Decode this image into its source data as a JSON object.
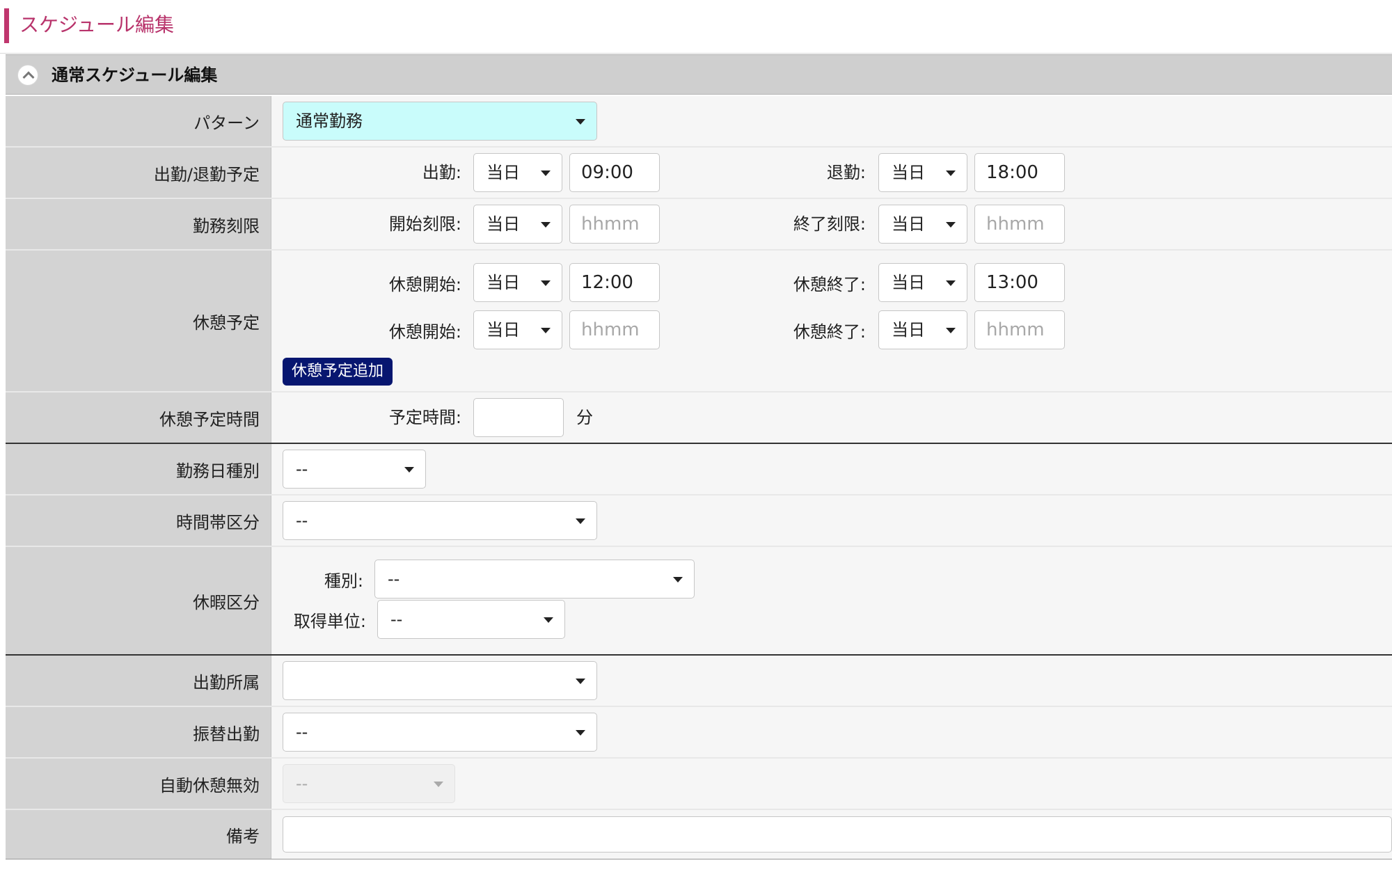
{
  "page": {
    "title": "スケジュール編集"
  },
  "section": {
    "title": "通常スケジュール編集"
  },
  "colors": {
    "accent": "#c0366e",
    "pattern_bg": "#c9fcfb",
    "button_bg": "#071670"
  },
  "pattern": {
    "label": "パターン",
    "value": "通常勤務"
  },
  "attendance": {
    "label": "出勤/退勤予定",
    "start_label": "出勤:",
    "start_day": "当日",
    "start_time": "09:00",
    "end_label": "退勤:",
    "end_day": "当日",
    "end_time": "18:00"
  },
  "work_limit": {
    "label": "勤務刻限",
    "start_label": "開始刻限:",
    "start_day": "当日",
    "start_placeholder": "hhmm",
    "end_label": "終了刻限:",
    "end_day": "当日",
    "end_placeholder": "hhmm"
  },
  "breaks": {
    "label": "休憩予定",
    "rows": [
      {
        "start_label": "休憩開始:",
        "start_day": "当日",
        "start_time": "12:00",
        "end_label": "休憩終了:",
        "end_day": "当日",
        "end_time": "13:00"
      },
      {
        "start_label": "休憩開始:",
        "start_day": "当日",
        "start_placeholder": "hhmm",
        "end_label": "休憩終了:",
        "end_day": "当日",
        "end_placeholder": "hhmm"
      }
    ],
    "add_button": "休憩予定追加"
  },
  "break_time": {
    "label": "休憩予定時間",
    "field_label": "予定時間:",
    "value": "",
    "unit": "分"
  },
  "workday_type": {
    "label": "勤務日種別",
    "value": "--"
  },
  "time_zone": {
    "label": "時間帯区分",
    "value": "--"
  },
  "leave": {
    "label": "休暇区分",
    "type_label": "種別:",
    "type_value": "--",
    "unit_label": "取得単位:",
    "unit_value": "--"
  },
  "department": {
    "label": "出勤所属",
    "value": ""
  },
  "substitute": {
    "label": "振替出勤",
    "value": "--"
  },
  "auto_break": {
    "label": "自動休憩無効",
    "value": "--"
  },
  "remarks": {
    "label": "備考",
    "value": ""
  }
}
